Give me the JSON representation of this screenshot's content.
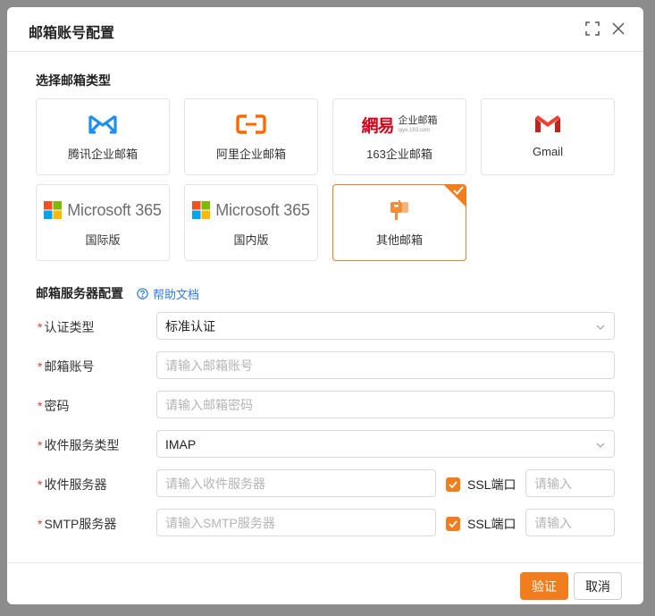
{
  "dialog": {
    "title": "邮箱账号配置",
    "fullscreen_icon": "fullscreen-icon",
    "close_icon": "close-icon"
  },
  "mail_type": {
    "section_title": "选择邮箱类型",
    "options": [
      {
        "label": "腾讯企业邮箱",
        "icon": "tencent-exmail-logo",
        "selected": false
      },
      {
        "label": "阿里企业邮箱",
        "icon": "aliyun-mail-logo",
        "selected": false
      },
      {
        "label": "163企业邮箱",
        "icon": "netease-163-logo",
        "logo_text": "網易",
        "logo_sub": "企业邮箱",
        "logo_url": "qiye.163.com",
        "selected": false
      },
      {
        "label": "Gmail",
        "icon": "gmail-logo",
        "selected": false
      },
      {
        "label": "国际版",
        "icon": "microsoft-365-logo",
        "logo_text": "Microsoft 365",
        "selected": false
      },
      {
        "label": "国内版",
        "icon": "microsoft-365-logo",
        "logo_text": "Microsoft 365",
        "selected": false
      },
      {
        "label": "其他邮箱",
        "icon": "mailbox-icon",
        "selected": true
      }
    ]
  },
  "server_config": {
    "section_title": "邮箱服务器配置",
    "help_link": "帮助文档",
    "fields": {
      "auth_type": {
        "label": "认证类型",
        "value": "标准认证"
      },
      "account": {
        "label": "邮箱账号",
        "placeholder": "请输入邮箱账号"
      },
      "password": {
        "label": "密码",
        "placeholder": "请输入邮箱密码"
      },
      "incoming_type": {
        "label": "收件服务类型",
        "value": "IMAP"
      },
      "incoming_server": {
        "label": "收件服务器",
        "placeholder": "请输入收件服务器",
        "ssl_label": "SSL端口",
        "ssl_checked": true,
        "port_placeholder": "请输入"
      },
      "smtp_server": {
        "label": "SMTP服务器",
        "placeholder": "请输入SMTP服务器",
        "ssl_label": "SSL端口",
        "ssl_checked": true,
        "port_placeholder": "请输入"
      }
    }
  },
  "footer": {
    "verify_label": "验证",
    "cancel_label": "取消"
  },
  "colors": {
    "accent": "#f07d1e",
    "link": "#2f7de1",
    "required": "#e8412c"
  }
}
